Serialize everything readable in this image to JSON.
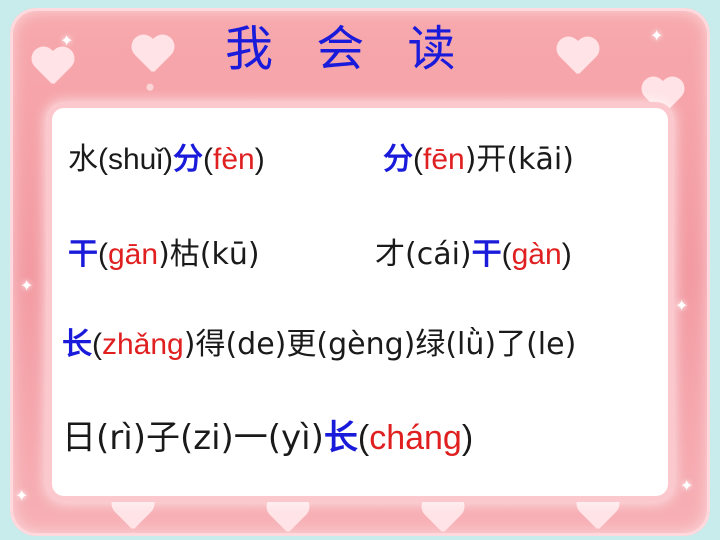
{
  "title": "我 会 读",
  "lines": [
    [
      {
        "text": "水",
        "color": "black"
      },
      {
        "text": "(shuǐ)",
        "color": "black"
      },
      {
        "text": "分",
        "color": "blue"
      },
      {
        "text": "(",
        "color": "black"
      },
      {
        "text": "fèn",
        "color": "red"
      },
      {
        "text": ")",
        "color": "black"
      }
    ],
    [
      {
        "text": "分",
        "color": "blue"
      },
      {
        "text": "(",
        "color": "black"
      },
      {
        "text": "fēn",
        "color": "red"
      },
      {
        "text": ")开(kāi)",
        "color": "black"
      }
    ],
    [
      {
        "text": "干",
        "color": "blue"
      },
      {
        "text": "(",
        "color": "black"
      },
      {
        "text": "gān",
        "color": "red"
      },
      {
        "text": ")枯(kū)",
        "color": "black"
      }
    ],
    [
      {
        "text": "才(cái)",
        "color": "black"
      },
      {
        "text": "干",
        "color": "blue"
      },
      {
        "text": "(",
        "color": "black"
      },
      {
        "text": "gàn",
        "color": "red"
      },
      {
        "text": ")",
        "color": "black"
      }
    ],
    [
      {
        "text": "长",
        "color": "blue"
      },
      {
        "text": "(",
        "color": "black"
      },
      {
        "text": "zhǎng",
        "color": "red"
      },
      {
        "text": ")得(de)更(gèng)绿(lǜ)了(le)",
        "color": "black"
      }
    ],
    [
      {
        "text": "日(rì)子(zi)一(yì)",
        "color": "black"
      },
      {
        "text": "长",
        "color": "blue"
      },
      {
        "text": "(",
        "color": "black"
      },
      {
        "text": "cháng",
        "color": "red"
      },
      {
        "text": ")",
        "color": "black"
      }
    ]
  ],
  "colors": {
    "blue": "#1a1adb",
    "red": "#e02020",
    "black": "#1a1a1a",
    "frame_pink": "#f39aa2",
    "background": "#c8ecec"
  },
  "decorations": [
    "heart-icon",
    "sparkle-icon"
  ]
}
